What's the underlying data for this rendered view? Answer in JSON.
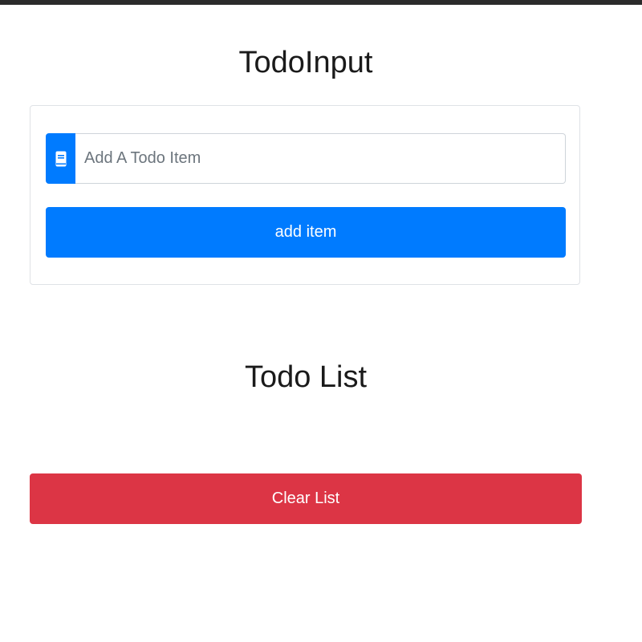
{
  "todo_input": {
    "title": "TodoInput",
    "input": {
      "value": "",
      "placeholder": "Add A Todo Item",
      "icon": "book-icon"
    },
    "add_button_label": "add item"
  },
  "todo_list": {
    "title": "Todo List",
    "items": [],
    "clear_button_label": "Clear List"
  },
  "colors": {
    "primary": "#007bff",
    "danger": "#dc3545",
    "card_border": "#dfe2e6"
  }
}
